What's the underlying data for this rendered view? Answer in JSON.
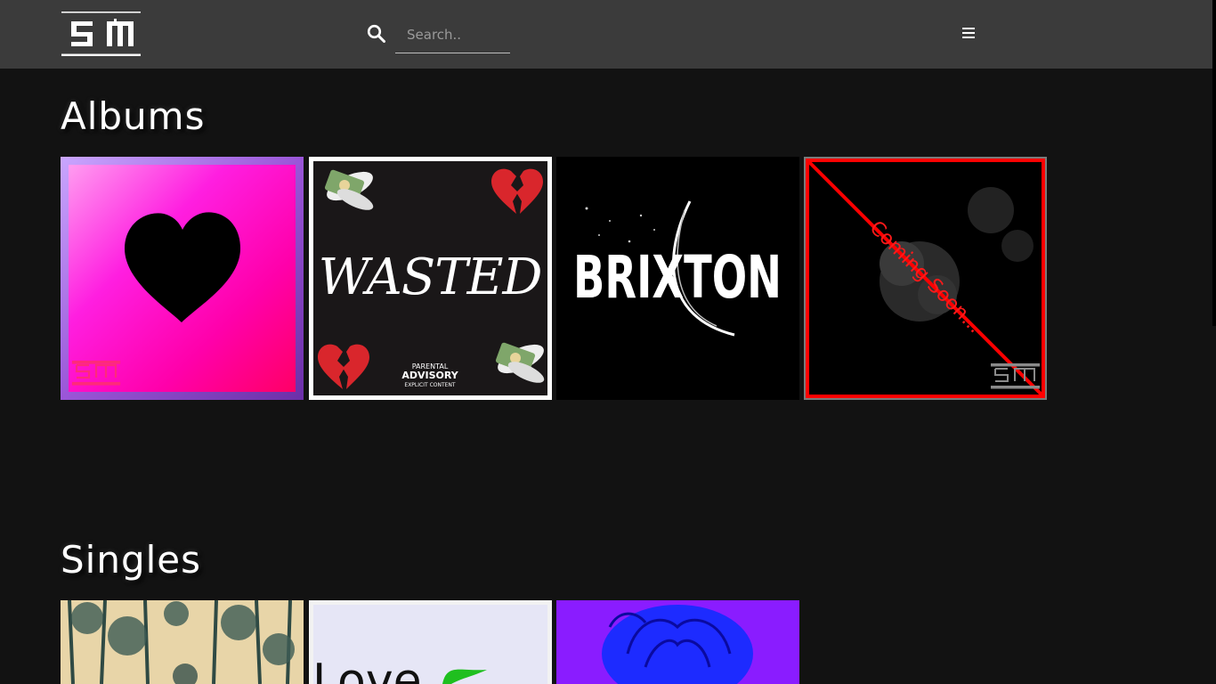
{
  "header": {
    "logo_text": "SM",
    "search": {
      "placeholder": "Search..",
      "value": ""
    },
    "icons": {
      "search": "search-icon",
      "menu": "hamburger-menu-icon"
    }
  },
  "albums": {
    "title": "Albums",
    "items": [
      {
        "name": "heart-album",
        "cover_text": ""
      },
      {
        "name": "wasted-album",
        "cover_text": "WASTED",
        "advisory": [
          "PARENTAL",
          "ADVISORY",
          "EXPLICIT CONTENT"
        ]
      },
      {
        "name": "brixton-album",
        "cover_text": "BRIXTON"
      },
      {
        "name": "coming-soon-album",
        "cover_text": "Coming Soon..."
      }
    ]
  },
  "singles": {
    "title": "Singles",
    "items": [
      {
        "name": "forest-single",
        "cover_text": ""
      },
      {
        "name": "love-single",
        "cover_text": "Love"
      },
      {
        "name": "rose-single",
        "cover_text": ""
      }
    ]
  },
  "colors": {
    "background": "#121212",
    "header": "#3b3b3b",
    "pink": "#ff00cc",
    "coming_soon_red": "#ff0000",
    "blue": "#2233ff"
  }
}
